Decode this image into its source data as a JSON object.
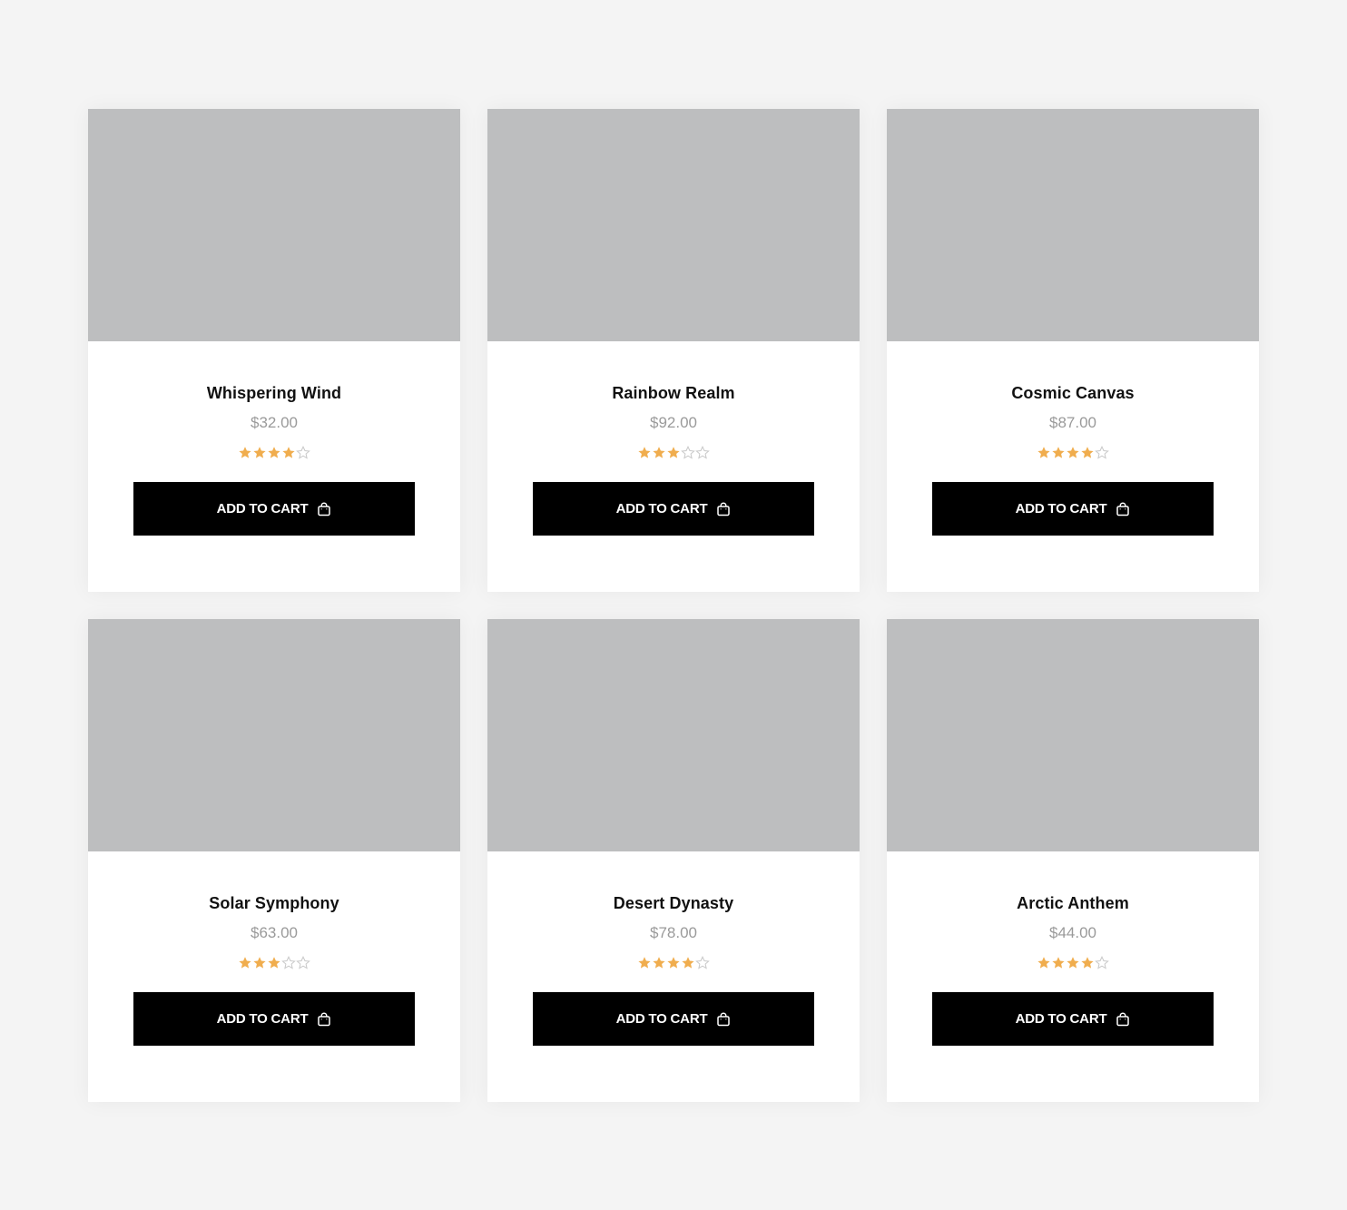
{
  "colors": {
    "page_background": "#f4f4f4",
    "card_background": "#ffffff",
    "image_placeholder": "#bdbebf",
    "star_filled": "#f0ad4e",
    "star_empty": "#c8c8c8",
    "button_background": "#000000",
    "button_text": "#ffffff",
    "price_text": "#9a9a9a"
  },
  "icons": {
    "star": "star-icon",
    "cart": "shopping-bag-icon"
  },
  "products": [
    {
      "name": "Whispering Wind",
      "price": "$32.00",
      "rating": 4,
      "rating_max": 5,
      "button_label": "ADD TO CART"
    },
    {
      "name": "Rainbow Realm",
      "price": "$92.00",
      "rating": 3,
      "rating_max": 5,
      "button_label": "ADD TO CART"
    },
    {
      "name": "Cosmic Canvas",
      "price": "$87.00",
      "rating": 4,
      "rating_max": 5,
      "button_label": "ADD TO CART"
    },
    {
      "name": "Solar Symphony",
      "price": "$63.00",
      "rating": 3,
      "rating_max": 5,
      "button_label": "ADD TO CART"
    },
    {
      "name": "Desert Dynasty",
      "price": "$78.00",
      "rating": 4,
      "rating_max": 5,
      "button_label": "ADD TO CART"
    },
    {
      "name": "Arctic Anthem",
      "price": "$44.00",
      "rating": 4,
      "rating_max": 5,
      "button_label": "ADD TO CART"
    }
  ]
}
